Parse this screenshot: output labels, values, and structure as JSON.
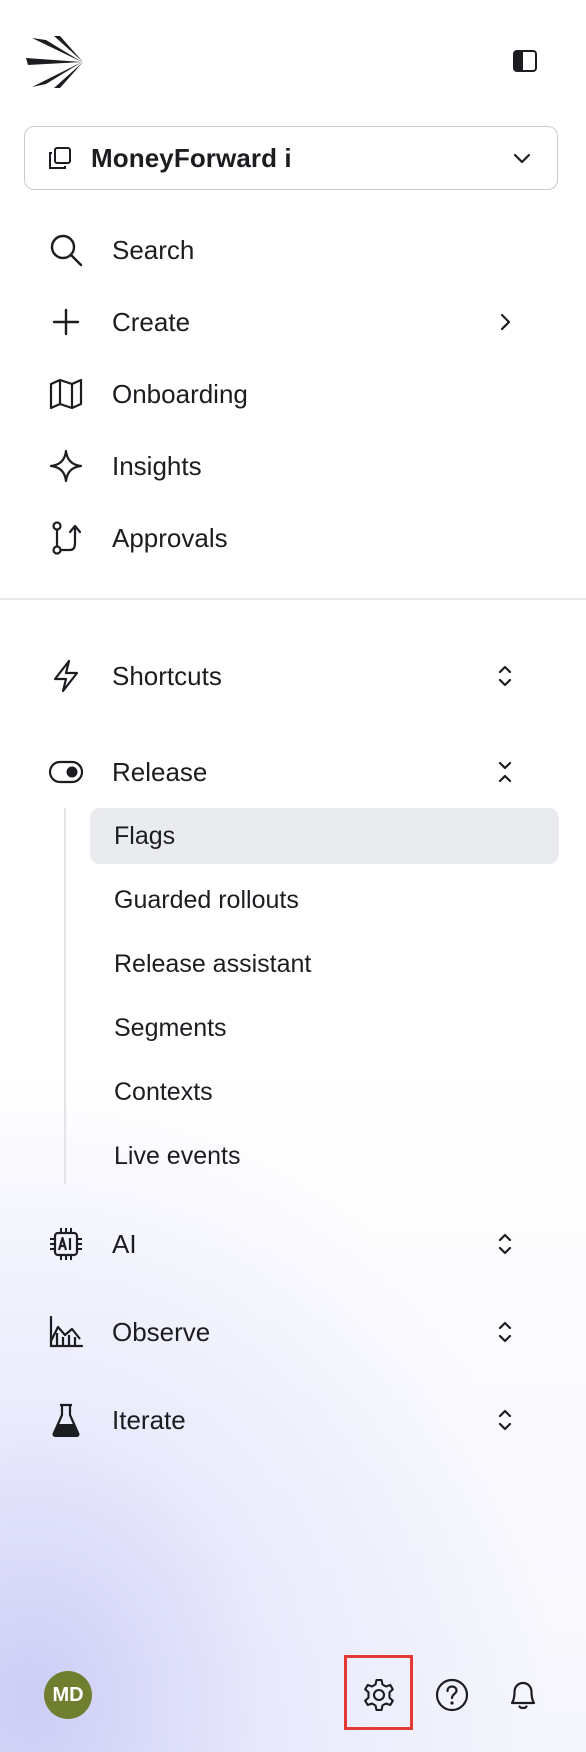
{
  "sidebar": {
    "logo_icon": "launchdarkly-arrow-logo",
    "collapse_icon": "sidebar-collapse-icon",
    "project": {
      "name": "MoneyForward i",
      "icon": "copy-stack-icon"
    },
    "nav": [
      {
        "label": "Search",
        "icon": "search-icon"
      },
      {
        "label": "Create",
        "icon": "plus-icon"
      },
      {
        "label": "Onboarding",
        "icon": "map-icon"
      },
      {
        "label": "Insights",
        "icon": "sparkle-icon"
      },
      {
        "label": "Approvals",
        "icon": "git-pull-icon"
      }
    ],
    "sections": [
      {
        "label": "Shortcuts",
        "icon": "lightning-icon",
        "expanded": false
      },
      {
        "label": "Release",
        "icon": "toggle-icon",
        "expanded": true,
        "items": [
          {
            "label": "Flags",
            "active": true
          },
          {
            "label": "Guarded rollouts"
          },
          {
            "label": "Release assistant"
          },
          {
            "label": "Segments"
          },
          {
            "label": "Contexts"
          },
          {
            "label": "Live events"
          }
        ]
      },
      {
        "label": "AI",
        "icon": "ai-chip-icon",
        "expanded": false
      },
      {
        "label": "Observe",
        "icon": "area-chart-icon",
        "expanded": false
      },
      {
        "label": "Iterate",
        "icon": "flask-icon",
        "expanded": false
      }
    ]
  },
  "footer": {
    "avatar_initials": "MD",
    "avatar_color": "#6f7f2f",
    "buttons": [
      "settings-gear-icon",
      "help-circle-icon",
      "bell-icon"
    ]
  },
  "colors": {
    "active_bg": "#e9ebef",
    "highlight": "#e53935",
    "text": "#1c1d21"
  }
}
